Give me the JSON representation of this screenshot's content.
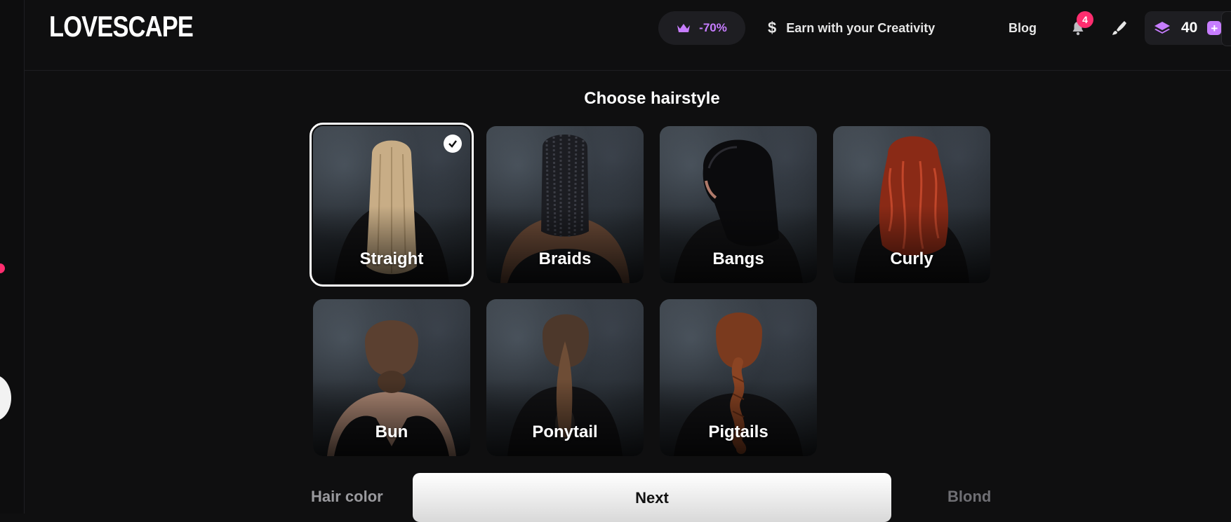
{
  "header": {
    "logo": "LOVESCAPE",
    "promo_label": "-70%",
    "promo_icon": "crown-icon",
    "earn_label": "Earn with your Creativity",
    "earn_icon": "dollar-icon",
    "blog_label": "Blog",
    "notifications_count": "4",
    "credits_count": "40",
    "credits_plus": "+"
  },
  "main": {
    "title": "Choose hairstyle",
    "hairstyles": [
      {
        "label": "Straight",
        "selected": true
      },
      {
        "label": "Braids",
        "selected": false
      },
      {
        "label": "Bangs",
        "selected": false
      },
      {
        "label": "Curly",
        "selected": false
      },
      {
        "label": "Bun",
        "selected": false
      },
      {
        "label": "Ponytail",
        "selected": false
      },
      {
        "label": "Pigtails",
        "selected": false
      }
    ]
  },
  "footer": {
    "hair_color_label": "Hair color",
    "next_label": "Next",
    "blond_label": "Blond"
  },
  "colors": {
    "accent": "#c77dff",
    "badge": "#ff2d6f",
    "background": "#0f0f10"
  }
}
